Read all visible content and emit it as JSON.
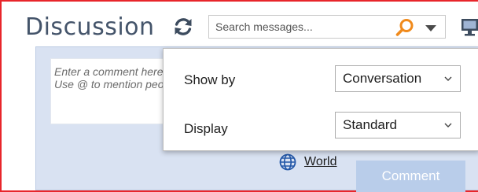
{
  "header": {
    "title": "Discussion"
  },
  "search": {
    "placeholder": "Search messages..."
  },
  "composer": {
    "placeholder_line1": "Enter a comment here.",
    "placeholder_line2": "Use @ to mention people."
  },
  "footer": {
    "visibility_label": "World",
    "comment_button_label": "Comment"
  },
  "view_options": {
    "show_by_label": "Show by",
    "show_by_value": "Conversation",
    "display_label": "Display",
    "display_value": "Standard"
  },
  "colors": {
    "frame_border": "#e8252b",
    "title_text": "#44546a",
    "search_accent": "#f08a1c",
    "panel_background": "#d9e2f2",
    "comment_button": "#b9cdea",
    "icon_dark": "#3c4b5e"
  },
  "icons": {
    "refresh": "refresh-icon",
    "search": "search-icon",
    "dropdown": "chevron-down-icon",
    "monitor": "monitor-icon",
    "globe": "globe-icon",
    "select_chevron": "chevron-down-icon"
  }
}
